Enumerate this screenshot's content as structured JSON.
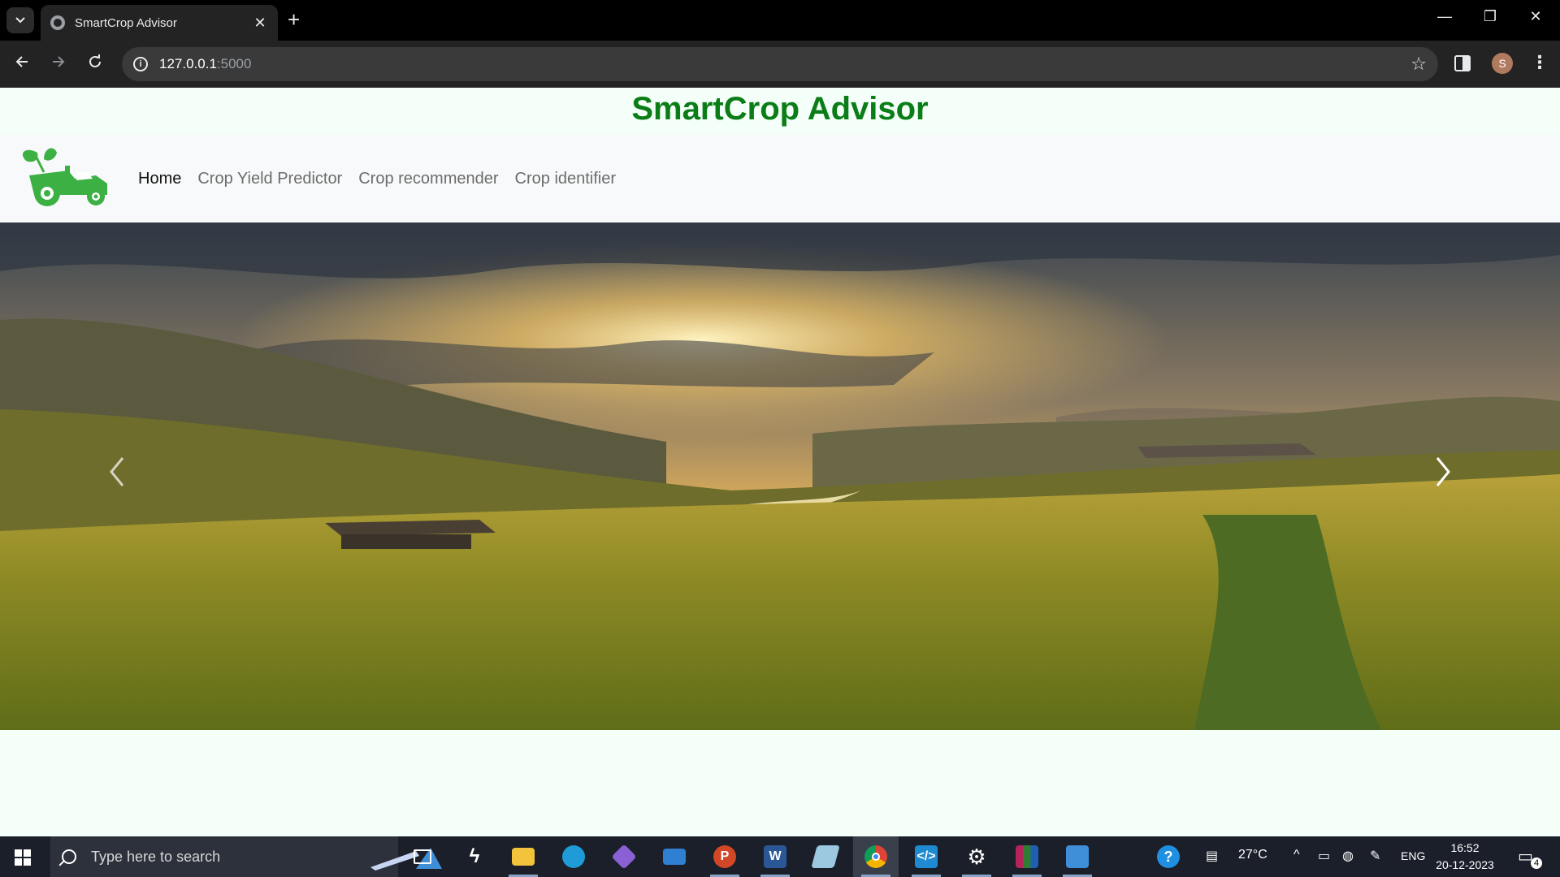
{
  "browser": {
    "tab_title": "SmartCrop Advisor",
    "tab_close": "✕",
    "new_tab": "+",
    "url_host": "127.0.0.1",
    "url_port": ":5000",
    "profile_initial": "S",
    "window_controls": {
      "minimize": "—",
      "restore": "❐",
      "close": "✕"
    }
  },
  "page": {
    "site_title": "SmartCrop Advisor",
    "nav": {
      "items": [
        {
          "label": "Home",
          "active": true
        },
        {
          "label": "Crop Yield Predictor",
          "active": false
        },
        {
          "label": "Crop recommender",
          "active": false
        },
        {
          "label": "Crop identifier",
          "active": false
        }
      ]
    },
    "colors": {
      "title_green": "#0b7d17",
      "logo_green": "#3cb043",
      "page_bg": "#f3fff8"
    }
  },
  "taskbar": {
    "search_placeholder": "Type here to search",
    "apps": [
      "task-view",
      "app-s",
      "file-explorer",
      "edge",
      "git",
      "mail",
      "powerpoint",
      "word",
      "notepad",
      "chrome",
      "vscode",
      "settings",
      "winrar",
      "photos"
    ],
    "weather": "27°C",
    "language": "ENG",
    "time": "16:52",
    "date": "20-12-2023",
    "notification_count": "4"
  }
}
